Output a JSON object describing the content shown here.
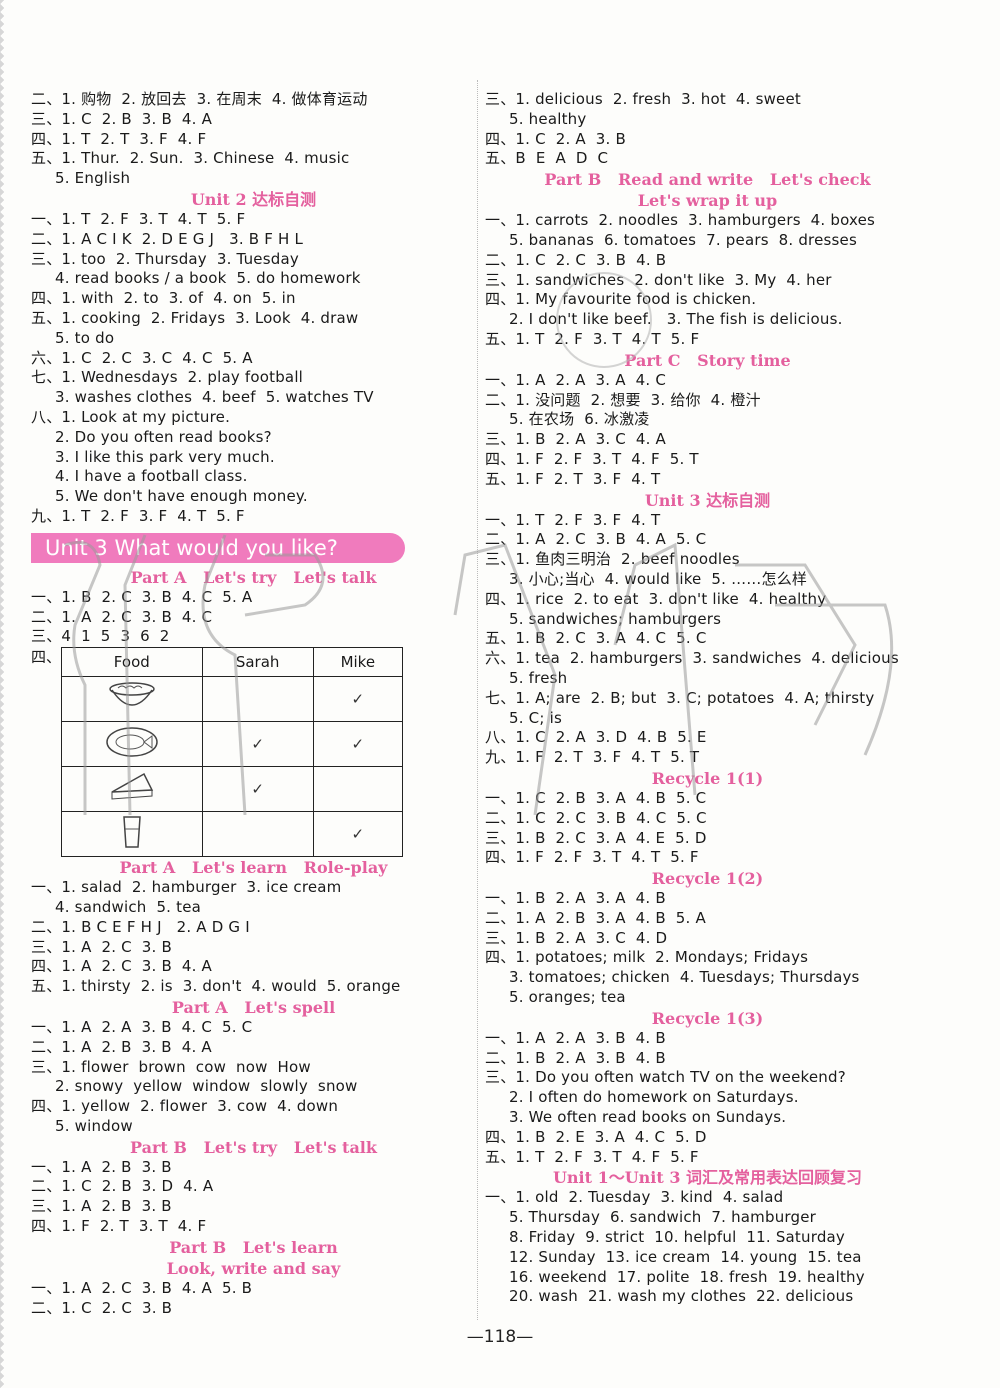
{
  "page_number": "—118—",
  "left_column": [
    {
      "type": "line",
      "lead": "二、",
      "text": "1. 购物  2. 放回去  3. 在周末  4. 做体育运动"
    },
    {
      "type": "line",
      "lead": "三、",
      "text": "1. C  2. B  3. B  4. A"
    },
    {
      "type": "line",
      "lead": "四、",
      "text": "1. T  2. T  3. F  4. F"
    },
    {
      "type": "line",
      "lead": "五、",
      "text": "1. Thur.  2. Sun.  3. Chinese  4. music"
    },
    {
      "type": "indent",
      "text": "5. English"
    },
    {
      "type": "heading",
      "text": "Unit 2 达标自测"
    },
    {
      "type": "line",
      "lead": "一、",
      "text": "1. T  2. F  3. T  4. T  5. F"
    },
    {
      "type": "line",
      "lead": "二、",
      "text": "1. A C I K  2. D E G J   3. B F H L"
    },
    {
      "type": "line",
      "lead": "三、",
      "text": "1. too  2. Thursday  3. Tuesday"
    },
    {
      "type": "indent",
      "text": "4. read books / a book  5. do homework"
    },
    {
      "type": "line",
      "lead": "四、",
      "text": "1. with  2. to  3. of  4. on  5. in"
    },
    {
      "type": "line",
      "lead": "五、",
      "text": "1. cooking  2. Fridays  3. Look  4. draw"
    },
    {
      "type": "indent",
      "text": "5. to do"
    },
    {
      "type": "line",
      "lead": "六、",
      "text": "1. C  2. C  3. C  4. C  5. A"
    },
    {
      "type": "line",
      "lead": "七、",
      "text": "1. Wednesdays  2. play football"
    },
    {
      "type": "indent",
      "text": "3. washes clothes  4. beef  5. watches TV"
    },
    {
      "type": "line",
      "lead": "八、",
      "text": "1. Look at my picture."
    },
    {
      "type": "indent",
      "text": "2. Do you often read books?"
    },
    {
      "type": "indent",
      "text": "3. I like this park very much."
    },
    {
      "type": "indent",
      "text": "4. I have a football class."
    },
    {
      "type": "indent",
      "text": "5. We don't have enough money."
    },
    {
      "type": "line",
      "lead": "九、",
      "text": "1. T  2. F  3. F  4. T  5. F"
    },
    {
      "type": "banner",
      "text": "Unit 3 What would you like?"
    },
    {
      "type": "heading",
      "text": "Part A   Let's try   Let's talk"
    },
    {
      "type": "line",
      "lead": "一、",
      "text": "1. B  2. C  3. B  4. C  5. A"
    },
    {
      "type": "line",
      "lead": "二、",
      "text": "1. A  2. C  3. B  4. C"
    },
    {
      "type": "line",
      "lead": "三、",
      "text": "4  1  5  3  6  2"
    },
    {
      "type": "table",
      "lead": "四、"
    },
    {
      "type": "heading",
      "text": "Part A   Let's learn   Role-play"
    },
    {
      "type": "line",
      "lead": "一、",
      "text": "1. salad  2. hamburger  3. ice cream"
    },
    {
      "type": "indent",
      "text": "4. sandwich  5. tea"
    },
    {
      "type": "line",
      "lead": "二、",
      "text": "1. B C E F H J   2. A D G I"
    },
    {
      "type": "line",
      "lead": "三、",
      "text": "1. A  2. C  3. B"
    },
    {
      "type": "line",
      "lead": "四、",
      "text": "1. A  2. C  3. B  4. A"
    },
    {
      "type": "line",
      "lead": "五、",
      "text": "1. thirsty  2. is  3. don't  4. would  5. orange"
    },
    {
      "type": "heading",
      "text": "Part A   Let's spell"
    },
    {
      "type": "line",
      "lead": "一、",
      "text": "1. A  2. A  3. B  4. C  5. C"
    },
    {
      "type": "line",
      "lead": "二、",
      "text": "1. A  2. B  3. B  4. A"
    },
    {
      "type": "line",
      "lead": "三、",
      "text": "1. flower  brown  cow  now  How"
    },
    {
      "type": "indent",
      "text": "2. snowy  yellow  window  slowly  snow"
    },
    {
      "type": "line",
      "lead": "四、",
      "text": "1. yellow  2. flower  3. cow  4. down"
    },
    {
      "type": "indent",
      "text": "5. window"
    },
    {
      "type": "heading",
      "text": "Part B   Let's try   Let's talk"
    },
    {
      "type": "line",
      "lead": "一、",
      "text": "1. A  2. B  3. B"
    },
    {
      "type": "line",
      "lead": "二、",
      "text": "1. C  2. B  3. D  4. A"
    },
    {
      "type": "line",
      "lead": "三、",
      "text": "1. A  2. B  3. B"
    },
    {
      "type": "line",
      "lead": "四、",
      "text": "1. F  2. T  3. T  4. F"
    },
    {
      "type": "heading",
      "text": "Part B   Let's learn"
    },
    {
      "type": "heading",
      "text": "Look, write and say"
    },
    {
      "type": "line",
      "lead": "一、",
      "text": "1. A  2. C  3. B  4. A  5. B"
    },
    {
      "type": "line",
      "lead": "二、",
      "text": "1. C  2. C  3. B"
    }
  ],
  "food_table": {
    "headers": [
      "Food",
      "Sarah",
      "Mike"
    ],
    "rows": [
      {
        "food": "noodles-bowl",
        "sarah": "",
        "mike": "✓"
      },
      {
        "food": "fish-plate",
        "sarah": "✓",
        "mike": "✓"
      },
      {
        "food": "sandwich",
        "sarah": "✓",
        "mike": ""
      },
      {
        "food": "glass-of-drink",
        "sarah": "",
        "mike": "✓"
      }
    ]
  },
  "right_column": [
    {
      "type": "line",
      "lead": "三、",
      "text": "1. delicious  2. fresh  3. hot  4. sweet"
    },
    {
      "type": "indent",
      "text": "5. healthy"
    },
    {
      "type": "line",
      "lead": "四、",
      "text": "1. C  2. A  3. B"
    },
    {
      "type": "line",
      "lead": "五、",
      "text": "B  E  A  D  C"
    },
    {
      "type": "heading",
      "text": "Part B   Read and write   Let's check"
    },
    {
      "type": "heading",
      "text": "Let's wrap it up"
    },
    {
      "type": "line",
      "lead": "一、",
      "text": "1. carrots  2. noodles  3. hamburgers  4. boxes"
    },
    {
      "type": "indent",
      "text": "5. bananas  6. tomatoes  7. pears  8. dresses"
    },
    {
      "type": "line",
      "lead": "二、",
      "text": "1. C  2. C  3. B  4. B"
    },
    {
      "type": "line",
      "lead": "三、",
      "text": "1. sandwiches  2. don't like  3. My  4. her"
    },
    {
      "type": "line",
      "lead": "四、",
      "text": "1. My favourite food is chicken."
    },
    {
      "type": "indent",
      "text": "2. I don't like beef.   3. The fish is delicious."
    },
    {
      "type": "line",
      "lead": "五、",
      "text": "1. T  2. F  3. T  4. T  5. F"
    },
    {
      "type": "heading",
      "text": "Part C   Story time"
    },
    {
      "type": "line",
      "lead": "一、",
      "text": "1. A  2. A  3. A  4. C"
    },
    {
      "type": "line",
      "lead": "二、",
      "text": "1. 没问题  2. 想要  3. 给你  4. 橙汁"
    },
    {
      "type": "indent",
      "text": "5. 在农场  6. 冰激凌"
    },
    {
      "type": "line",
      "lead": "三、",
      "text": "1. B  2. A  3. C  4. A"
    },
    {
      "type": "line",
      "lead": "四、",
      "text": "1. F  2. F  3. T  4. F  5. T"
    },
    {
      "type": "line",
      "lead": "五、",
      "text": "1. F  2. T  3. F  4. T"
    },
    {
      "type": "heading",
      "text": "Unit 3 达标自测"
    },
    {
      "type": "line",
      "lead": "一、",
      "text": "1. T  2. F  3. F  4. T"
    },
    {
      "type": "line",
      "lead": "二、",
      "text": "1. A  2. C  3. B  4. A  5. C"
    },
    {
      "type": "line",
      "lead": "三、",
      "text": "1. 鱼肉三明治  2. beef noodles"
    },
    {
      "type": "indent",
      "text": "3. 小心;当心  4. would like  5. ……怎么样"
    },
    {
      "type": "line",
      "lead": "四、",
      "text": "1. rice  2. to eat  3. don't like  4. healthy"
    },
    {
      "type": "indent",
      "text": "5. sandwiches; hamburgers"
    },
    {
      "type": "line",
      "lead": "五、",
      "text": "1. B  2. C  3. A  4. C  5. C"
    },
    {
      "type": "line",
      "lead": "六、",
      "text": "1. tea  2. hamburgers  3. sandwiches  4. delicious"
    },
    {
      "type": "indent",
      "text": "5. fresh"
    },
    {
      "type": "line",
      "lead": "七、",
      "text": "1. A; are  2. B; but  3. C; potatoes  4. A; thirsty"
    },
    {
      "type": "indent",
      "text": "5. C; is"
    },
    {
      "type": "line",
      "lead": "八、",
      "text": "1. C  2. A  3. D  4. B  5. E"
    },
    {
      "type": "line",
      "lead": "九、",
      "text": "1. F  2. T  3. F  4. T  5. T"
    },
    {
      "type": "heading",
      "text": "Recycle 1(1)"
    },
    {
      "type": "line",
      "lead": "一、",
      "text": "1. C  2. B  3. A  4. B  5. C"
    },
    {
      "type": "line",
      "lead": "二、",
      "text": "1. C  2. C  3. B  4. C  5. C"
    },
    {
      "type": "line",
      "lead": "三、",
      "text": "1. B  2. C  3. A  4. E  5. D"
    },
    {
      "type": "line",
      "lead": "四、",
      "text": "1. F  2. F  3. T  4. T  5. F"
    },
    {
      "type": "heading",
      "text": "Recycle 1(2)"
    },
    {
      "type": "line",
      "lead": "一、",
      "text": "1. B  2. A  3. A  4. B"
    },
    {
      "type": "line",
      "lead": "二、",
      "text": "1. A  2. B  3. A  4. B  5. A"
    },
    {
      "type": "line",
      "lead": "三、",
      "text": "1. B  2. A  3. C  4. D"
    },
    {
      "type": "line",
      "lead": "四、",
      "text": "1. potatoes; milk  2. Mondays; Fridays"
    },
    {
      "type": "indent",
      "text": "3. tomatoes; chicken  4. Tuesdays; Thursdays"
    },
    {
      "type": "indent",
      "text": "5. oranges; tea"
    },
    {
      "type": "heading",
      "text": "Recycle 1(3)"
    },
    {
      "type": "line",
      "lead": "一、",
      "text": "1. A  2. A  3. B  4. B"
    },
    {
      "type": "line",
      "lead": "二、",
      "text": "1. B  2. A  3. B  4. B"
    },
    {
      "type": "line",
      "lead": "三、",
      "text": "1. Do you often watch TV on the weekend?"
    },
    {
      "type": "indent",
      "text": "2. I often do homework on Saturdays."
    },
    {
      "type": "indent",
      "text": "3. We often read books on Sundays."
    },
    {
      "type": "line",
      "lead": "四、",
      "text": "1. B  2. E  3. A  4. C  5. D"
    },
    {
      "type": "line",
      "lead": "五、",
      "text": "1. T  2. F  3. T  4. F  5. F"
    },
    {
      "type": "heading",
      "text": "Unit 1～Unit 3 词汇及常用表达回顾复习"
    },
    {
      "type": "line",
      "lead": "一、",
      "text": "1. old  2. Tuesday  3. kind  4. salad"
    },
    {
      "type": "indent",
      "text": "5. Thursday  6. sandwich  7. hamburger"
    },
    {
      "type": "indent",
      "text": "8. Friday  9. strict  10. helpful  11. Saturday"
    },
    {
      "type": "indent",
      "text": "12. Sunday  13. ice cream  14. young  15. tea"
    },
    {
      "type": "indent",
      "text": "16. weekend  17. polite  18. fresh  19. healthy"
    },
    {
      "type": "indent",
      "text": "20. wash  21. wash my clothes  22. delicious"
    }
  ],
  "colors": {
    "heading": "#e4609e",
    "banner": "#f07bbd",
    "text": "#1a1a1a"
  }
}
